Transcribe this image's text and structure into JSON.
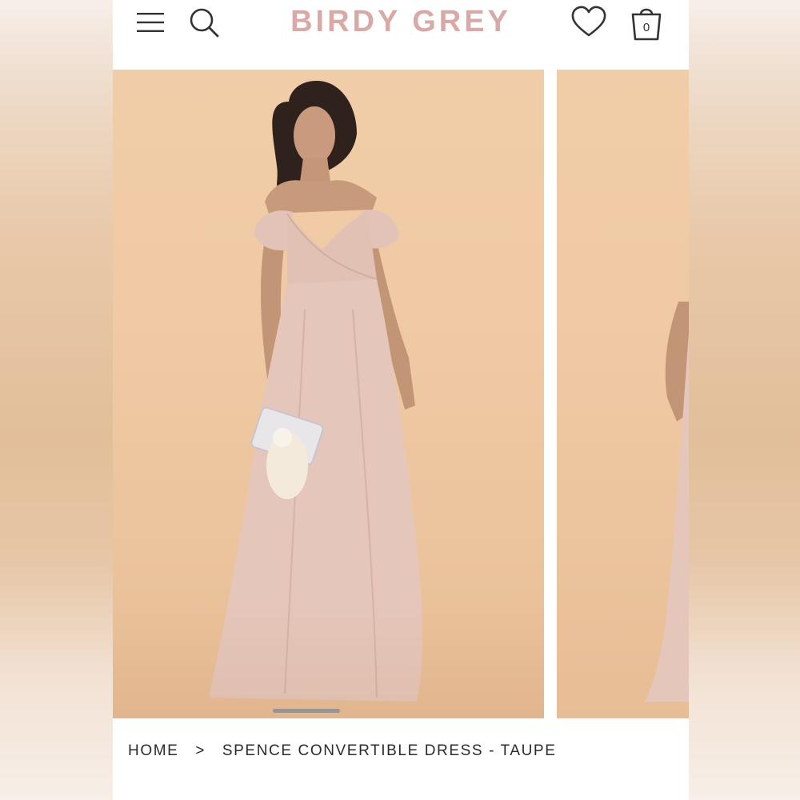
{
  "header": {
    "logo": "BIRDY GREY",
    "cart_count": "0",
    "icons": [
      "menu-icon",
      "search-icon",
      "heart-icon",
      "shopping-bag-icon"
    ]
  },
  "gallery": {
    "images": [
      "product-photo-front",
      "product-photo-next"
    ]
  },
  "breadcrumb": {
    "home": "HOME",
    "separator": ">",
    "current": "SPENCE CONVERTIBLE DRESS - TAUPE"
  },
  "colors": {
    "brand": "#d8a9a6",
    "background_photo": "#efc9a3",
    "dress": "#e3c2b6",
    "text": "#2b2b2b"
  }
}
